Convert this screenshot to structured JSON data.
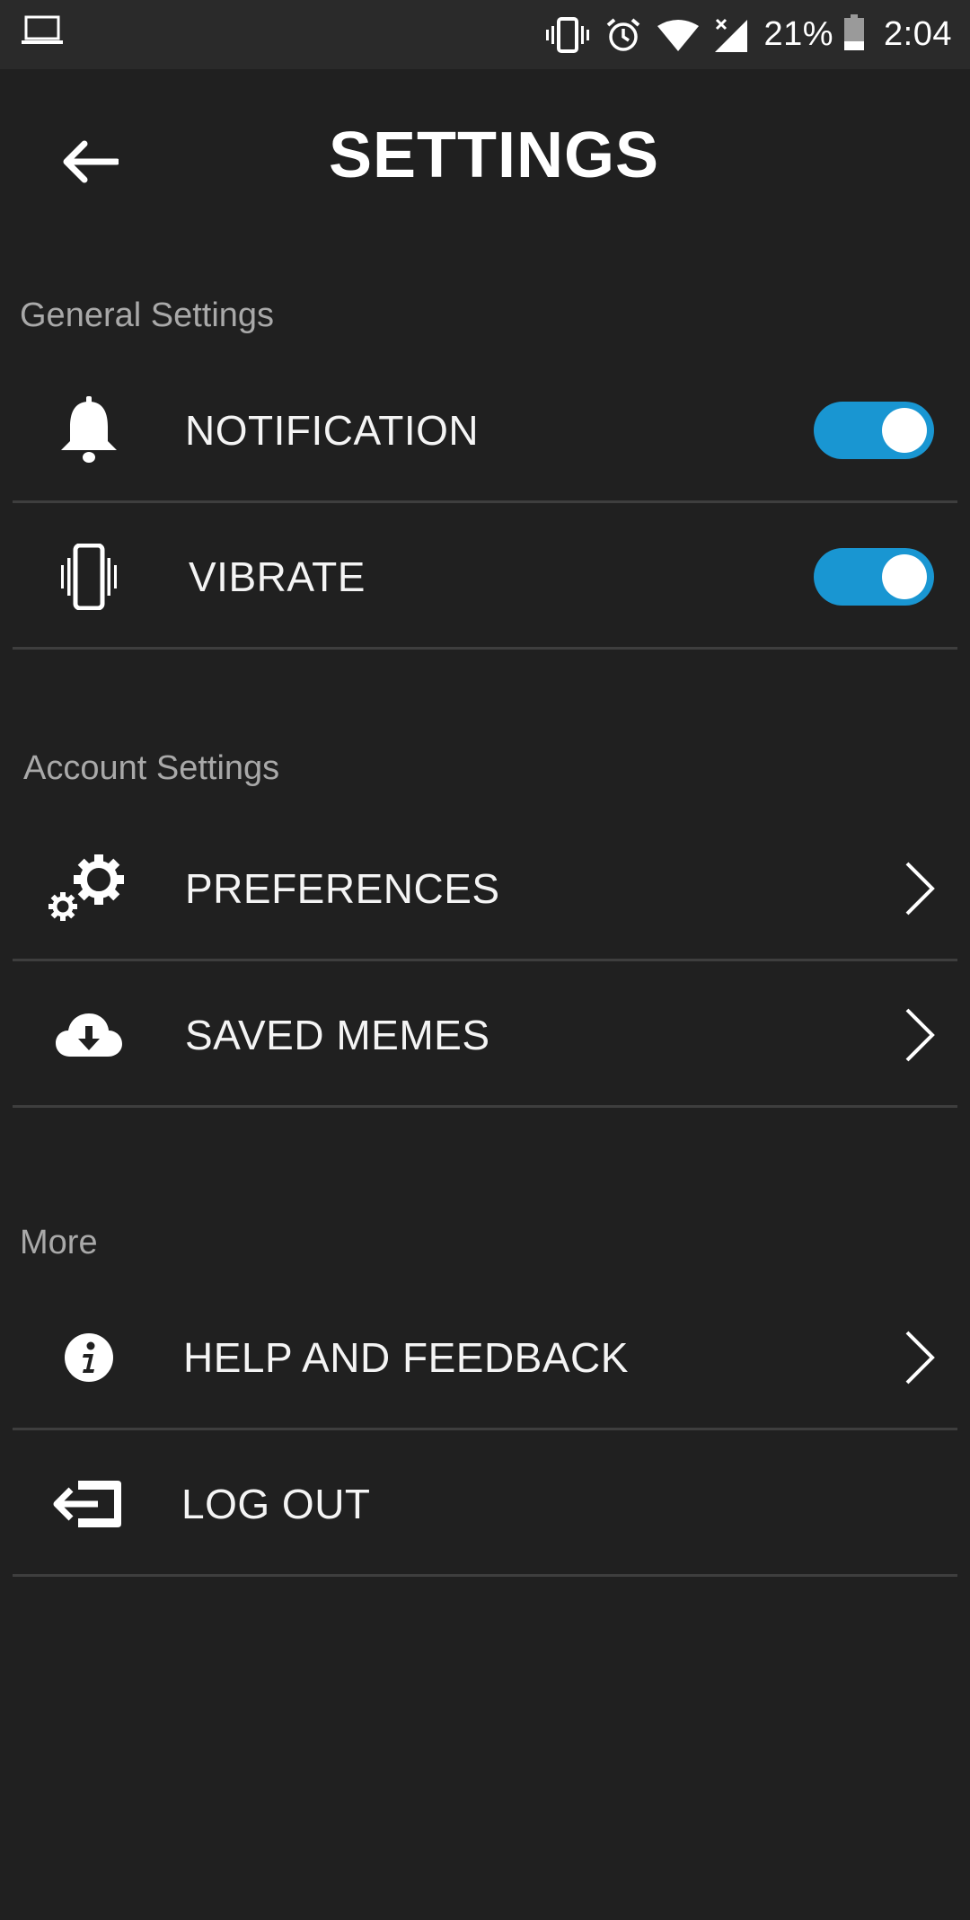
{
  "status_bar": {
    "battery_percent": "21%",
    "time": "2:04",
    "icons": [
      "laptop-icon",
      "vibrate-icon",
      "alarm-icon",
      "wifi-icon",
      "signal-icon",
      "battery-icon"
    ]
  },
  "header": {
    "title": "SETTINGS",
    "back_icon": "arrow-left-icon"
  },
  "sections": {
    "general": {
      "label": "General Settings",
      "notification": {
        "label": "NOTIFICATION",
        "icon": "bell-icon",
        "enabled": true
      },
      "vibrate": {
        "label": "VIBRATE",
        "icon": "phone-vibrate-icon",
        "enabled": true
      }
    },
    "account": {
      "label": "Account Settings",
      "preferences": {
        "label": "PREFERENCES",
        "icon": "gears-icon"
      },
      "saved_memes": {
        "label": "SAVED MEMES",
        "icon": "cloud-download-icon"
      }
    },
    "more": {
      "label": "More",
      "help": {
        "label": "HELP AND FEEDBACK",
        "icon": "info-icon"
      },
      "logout": {
        "label": "LOG OUT",
        "icon": "logout-icon"
      }
    }
  },
  "colors": {
    "background": "#202020",
    "status_bar": "#2a2a2a",
    "toggle_on": "#1996d2",
    "divider": "#3e3e3e",
    "section_label": "#a9a9a9"
  }
}
